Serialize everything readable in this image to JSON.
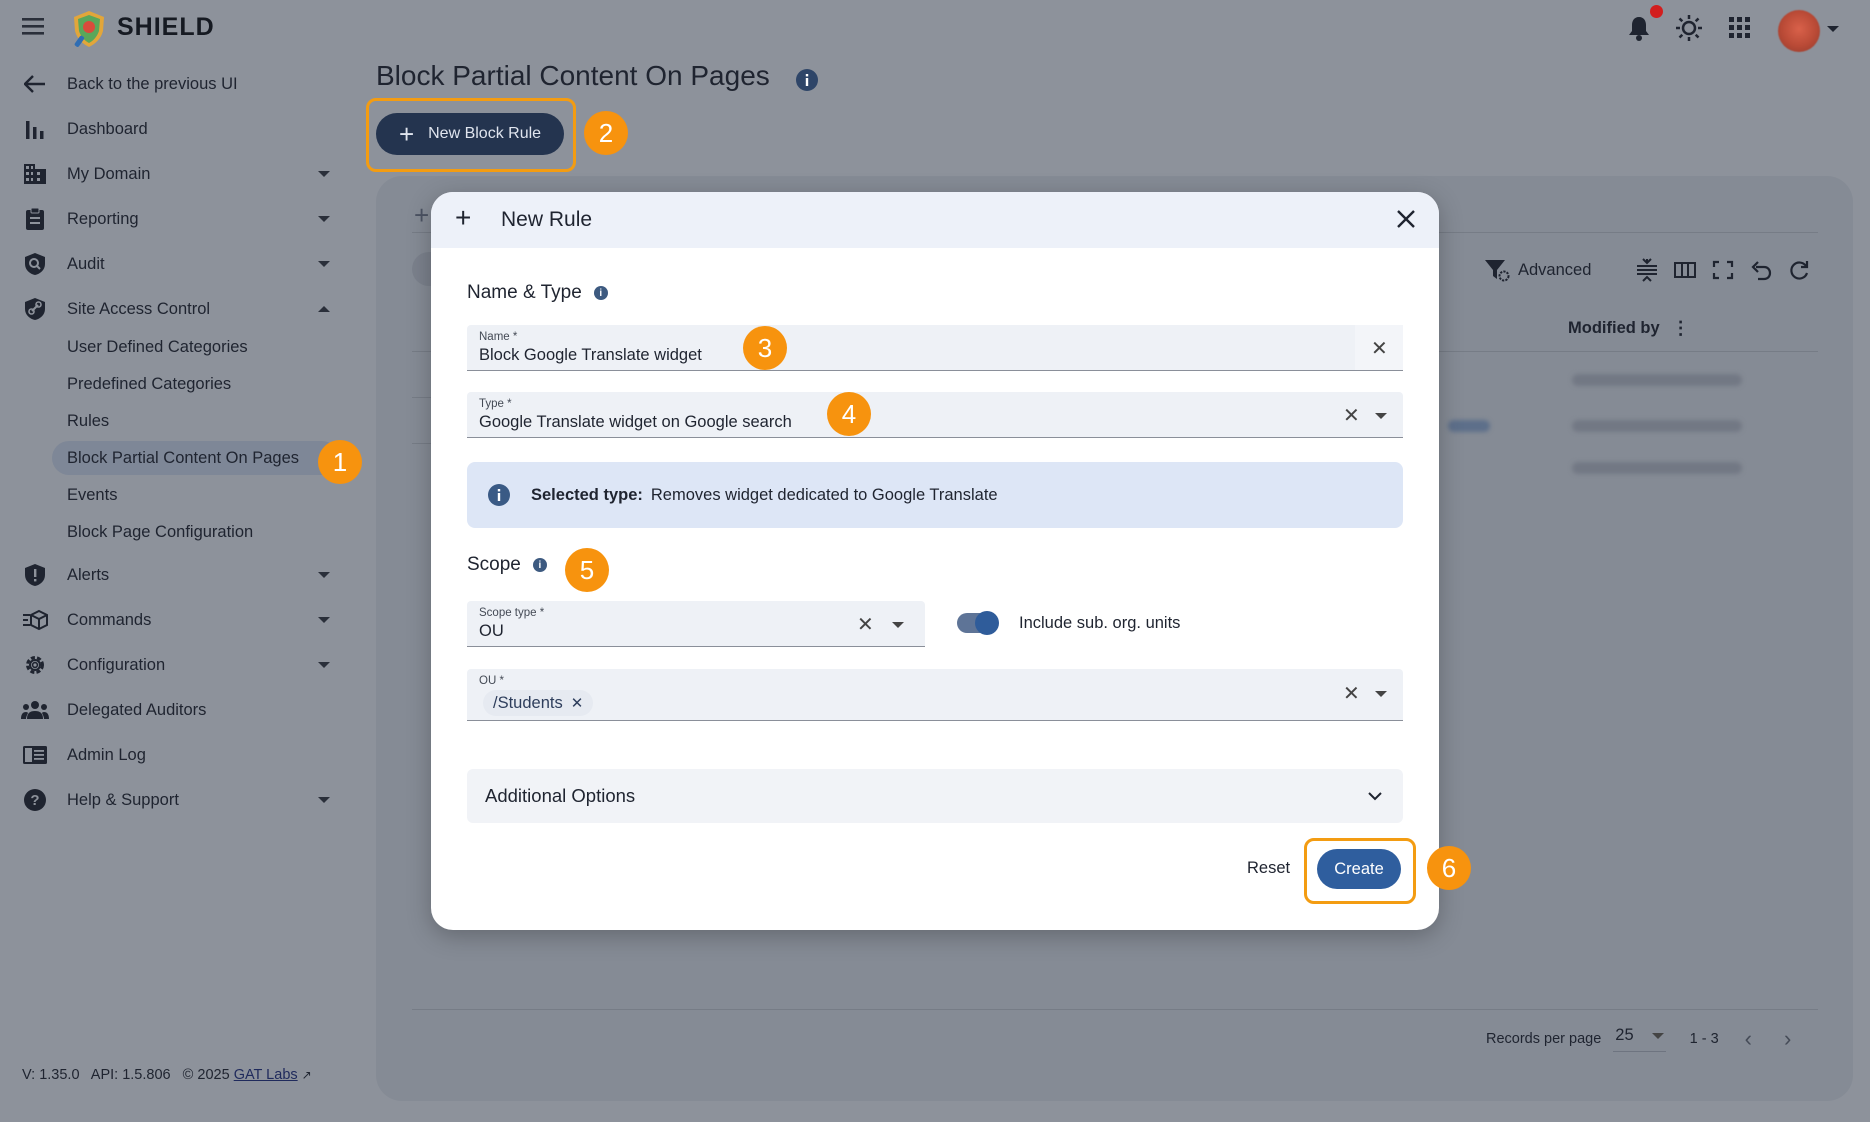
{
  "app": {
    "name": "SHIELD",
    "brand_color": "#24344f",
    "accent": "#f7930e"
  },
  "sidebar": {
    "back_label": "Back to the previous UI",
    "items": [
      {
        "label": "Dashboard",
        "icon": "bar-chart-icon"
      },
      {
        "label": "My Domain",
        "icon": "building-icon",
        "expandable": true
      },
      {
        "label": "Reporting",
        "icon": "clipboard-icon",
        "expandable": true
      },
      {
        "label": "Audit",
        "icon": "audit-shield-icon",
        "expandable": true
      },
      {
        "label": "Site Access Control",
        "icon": "shield-link-icon",
        "expandable": true,
        "expanded": true
      }
    ],
    "sub_items": [
      {
        "label": "User Defined Categories"
      },
      {
        "label": "Predefined Categories"
      },
      {
        "label": "Rules"
      },
      {
        "label": "Block Partial Content On Pages",
        "active": true
      },
      {
        "label": "Events"
      },
      {
        "label": "Block Page Configuration"
      }
    ],
    "items_after": [
      {
        "label": "Alerts",
        "icon": "alert-shield-icon",
        "expandable": true
      },
      {
        "label": "Commands",
        "icon": "commands-icon",
        "expandable": true
      },
      {
        "label": "Configuration",
        "icon": "gear-icon",
        "expandable": true
      },
      {
        "label": "Delegated Auditors",
        "icon": "people-icon"
      },
      {
        "label": "Admin Log",
        "icon": "log-icon"
      },
      {
        "label": "Help & Support",
        "icon": "help-icon",
        "expandable": true
      }
    ],
    "version": "V: 1.35.0   API: 1.5.806   © 2025",
    "company_link": "GAT Labs"
  },
  "page": {
    "title": "Block Partial Content On Pages",
    "new_button": "New Block Rule"
  },
  "table": {
    "advanced_label": "Advanced",
    "modified_by_header": "Modified by",
    "records_per_page_label": "Records per page",
    "records_per_page": "25",
    "range": "1 - 3"
  },
  "modal": {
    "title": "New Rule",
    "section_name_type": "Name & Type",
    "name_label": "Name *",
    "name_value": "Block Google Translate widget",
    "type_label": "Type *",
    "type_value": "Google Translate widget on Google search",
    "selected_type_label": "Selected type:",
    "selected_type_value": "Removes widget dedicated to Google Translate",
    "section_scope": "Scope",
    "scope_type_label": "Scope type *",
    "scope_type_value": "OU",
    "include_sub_label": "Include sub. org. units",
    "include_sub_on": true,
    "ou_label": "OU *",
    "ou_chip": "/Students",
    "additional_options": "Additional Options",
    "reset_label": "Reset",
    "create_label": "Create"
  },
  "step_badges": [
    "1",
    "2",
    "3",
    "4",
    "5",
    "6"
  ]
}
